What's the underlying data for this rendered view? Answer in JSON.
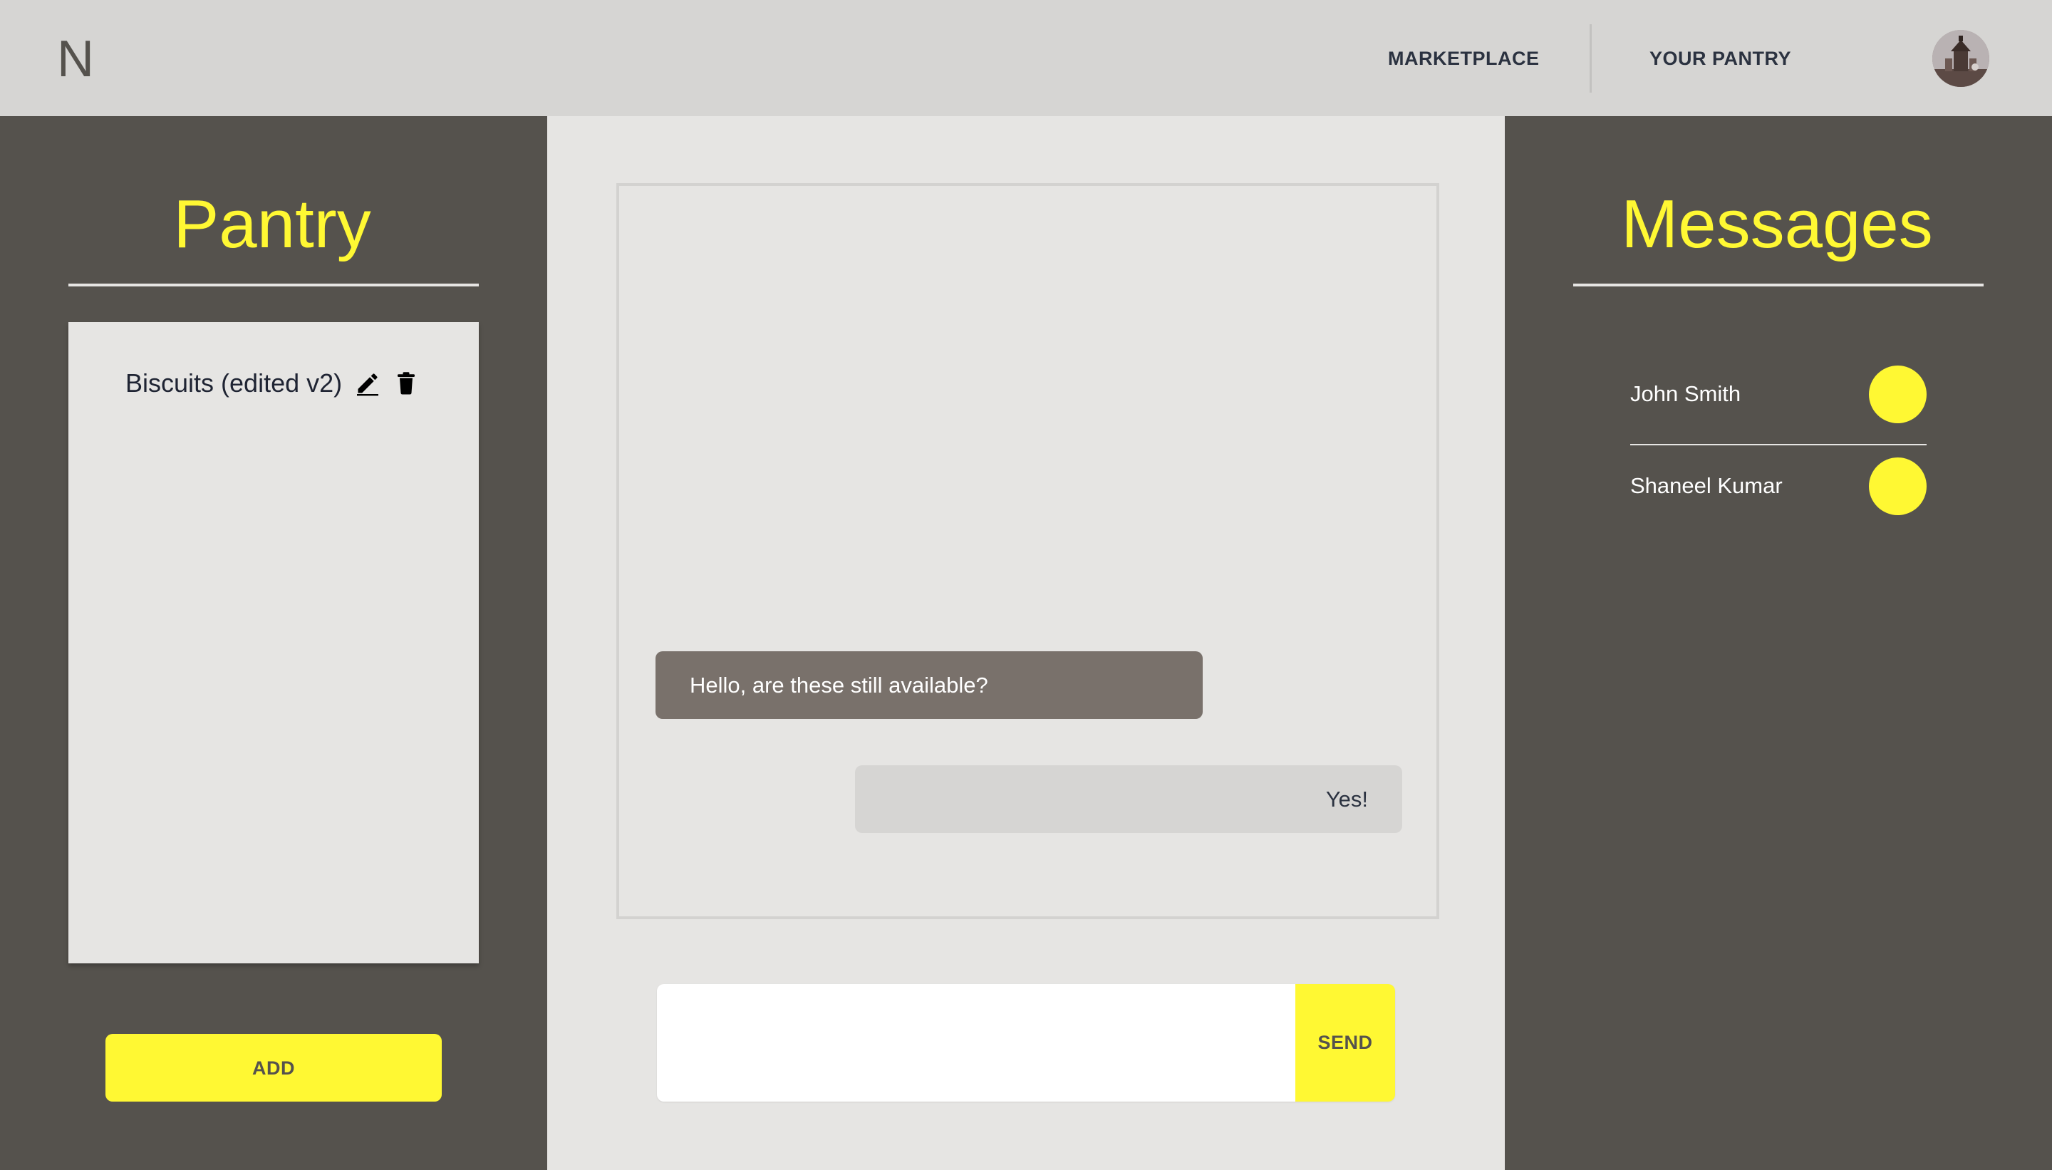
{
  "header": {
    "logo": "N",
    "nav": [
      {
        "label": "MARKETPLACE"
      },
      {
        "label": "YOUR PANTRY"
      }
    ],
    "avatar_icon": "user-avatar"
  },
  "pantry": {
    "title": "Pantry",
    "items": [
      {
        "name": "Biscuits (edited v2)",
        "icons": [
          "pencil-icon",
          "trash-icon"
        ]
      }
    ],
    "add_label": "ADD"
  },
  "chat": {
    "messages": [
      {
        "direction": "incoming",
        "text": "Hello, are these still available?"
      },
      {
        "direction": "outgoing",
        "text": "Yes!"
      }
    ],
    "input_value": "",
    "input_placeholder": "",
    "send_label": "SEND"
  },
  "messages": {
    "title": "Messages",
    "contacts": [
      {
        "name": "John Smith"
      },
      {
        "name": "Shaneel Kumar"
      }
    ]
  },
  "colors": {
    "accent": "#fff833",
    "panel": "#55524d",
    "header": "#d6d5d3",
    "canvas": "#e6e5e3",
    "incoming_bubble": "#79716b",
    "outgoing_bubble": "#d6d5d3"
  }
}
